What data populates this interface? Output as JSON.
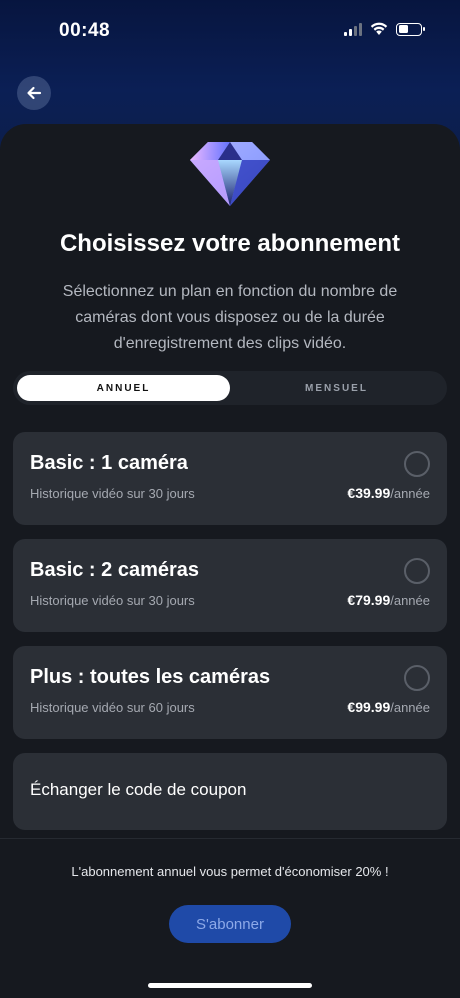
{
  "status_bar": {
    "time": "00:48",
    "icons": [
      "signal-icon",
      "wifi-icon",
      "battery-icon"
    ]
  },
  "header": {
    "back_icon": "arrow-left-icon",
    "logo_icon": "diamond-icon"
  },
  "title": "Choisissez votre abonnement",
  "subtitle": "Sélectionnez un plan en fonction du nombre de caméras dont vous disposez ou de la durée d'enregistrement des clips vidéo.",
  "tabs": [
    {
      "label": "ANNUEL",
      "selected": true
    },
    {
      "label": "MENSUEL",
      "selected": false
    }
  ],
  "plans": [
    {
      "name": "Basic : 1 caméra",
      "description": "Historique vidéo sur 30 jours",
      "price": "€39.99",
      "period": "/année",
      "selected": false
    },
    {
      "name": "Basic : 2 caméras",
      "description": "Historique vidéo sur 30 jours",
      "price": "€79.99",
      "period": "/année",
      "selected": false
    },
    {
      "name": "Plus : toutes les caméras",
      "description": "Historique vidéo sur 60 jours",
      "price": "€99.99",
      "period": "/année",
      "selected": false
    }
  ],
  "coupon": {
    "label": "Échanger le code de coupon"
  },
  "footer": {
    "savings_note": "L'abonnement annuel vous permet d'économiser 20% !",
    "subscribe_label": "S'abonner"
  },
  "colors": {
    "background": "#16191f",
    "card": "#2b2f36",
    "accent": "#1f4aa8",
    "header_blue": "#0b1f55"
  }
}
